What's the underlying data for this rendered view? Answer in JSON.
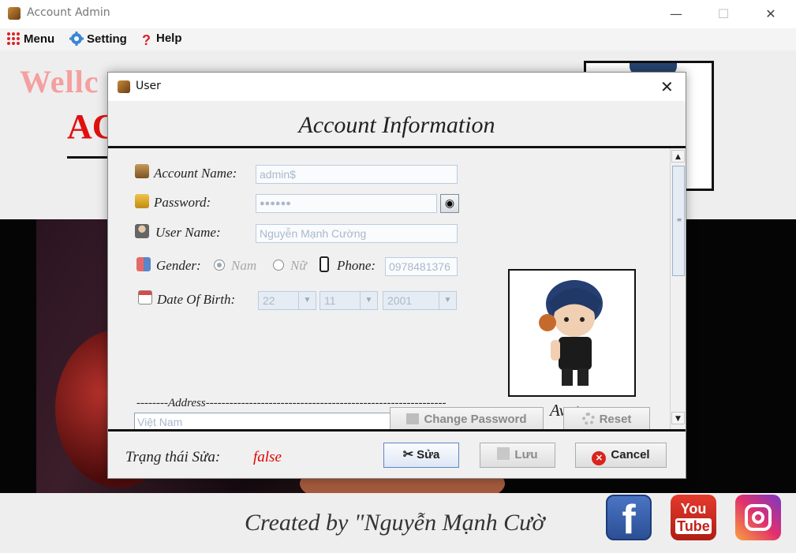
{
  "window": {
    "title": "Account Admin",
    "minimize": "—",
    "maximize": "☐",
    "close": "✕"
  },
  "menubar": {
    "items": [
      {
        "label": "Menu",
        "icon": "grid-icon"
      },
      {
        "label": "Setting",
        "icon": "gear-icon"
      },
      {
        "label": "Help",
        "icon": "question-icon"
      }
    ]
  },
  "background": {
    "welcome_text": "Wellc",
    "heading_partial": "AC",
    "credit": "Created by \"Nguyễn Mạnh Cườ",
    "social": {
      "facebook": "f",
      "youtube_top": "You",
      "youtube_bottom": "Tube"
    }
  },
  "dialog": {
    "title": "User",
    "close": "✕",
    "heading": "Account Information",
    "labels": {
      "account_name": "Account Name:",
      "password": "Password:",
      "user_name": "User Name:",
      "gender": "Gender:",
      "phone": "Phone:",
      "dob": "Date Of Birth:",
      "address": "--------Address-------------------------------------------------------------"
    },
    "fields": {
      "account_name": "admin$",
      "password": "●●●●●●",
      "user_name": "Nguyễn Mạnh Cường",
      "phone": "0978481376",
      "address": "Việt Nam"
    },
    "gender": {
      "options": [
        "Nam",
        "Nữ"
      ],
      "selected": "Nam"
    },
    "dob": {
      "day": "22",
      "month": "11",
      "year": "2001"
    },
    "avatar_label": "Avatar",
    "buttons": {
      "change_password": "Change Password",
      "reset": "Reset",
      "edit": "Sửa",
      "save": "Lưu",
      "cancel": "Cancel"
    },
    "status": {
      "label": "Trạng thái Sửa:",
      "value": "false"
    }
  }
}
